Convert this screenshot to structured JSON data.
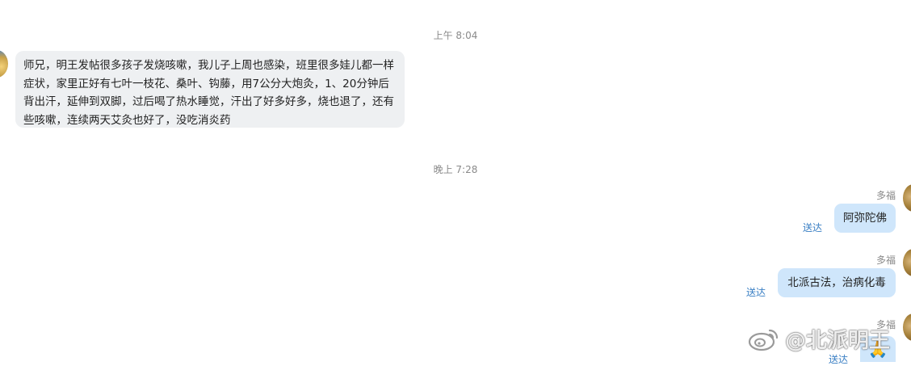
{
  "timestamps": [
    "上午 8:04",
    "晚上 7:28"
  ],
  "incoming": {
    "text": "师兄，明王发帖很多孩子发烧咳嗽，我儿子上周也感染，班里很多娃儿都一样症状，家里正好有七叶一枝花、桑叶、钩藤，用7公分大炮灸，1、20分钟后背出汗，延伸到双脚，过后喝了热水睡觉，汗出了好多好多，烧也退了，还有些咳嗽，连续两天艾灸也好了，没吃消炎药"
  },
  "outgoing": [
    {
      "sender": "多福",
      "text": "阿弥陀佛",
      "status": "送达"
    },
    {
      "sender": "多福",
      "text": "北派古法，治病化毒",
      "status": "送达"
    },
    {
      "sender": "多福",
      "text": "🙏",
      "status": "送达"
    }
  ],
  "watermark": {
    "text": "@北派明王"
  }
}
